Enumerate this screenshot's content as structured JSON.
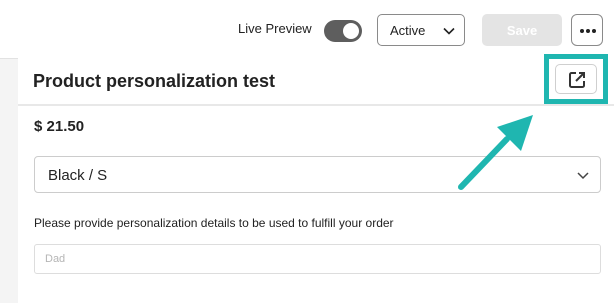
{
  "toolbar": {
    "live_preview_label": "Live Preview",
    "live_preview_on": true,
    "status_value": "Active",
    "save_label": "Save",
    "more_icon": "ellipsis-icon"
  },
  "product": {
    "title": "Product personalization test",
    "price": "$ 21.50",
    "variant_value": "Black / S",
    "instruction": "Please provide personalization details to be used to fulfill your order",
    "detail_placeholder": "Dad",
    "open_icon": "external-link-icon"
  },
  "colors": {
    "highlight": "#1fb6b0",
    "toggle_on": "#5e5e5e",
    "save_disabled": "#e4e4e4"
  }
}
